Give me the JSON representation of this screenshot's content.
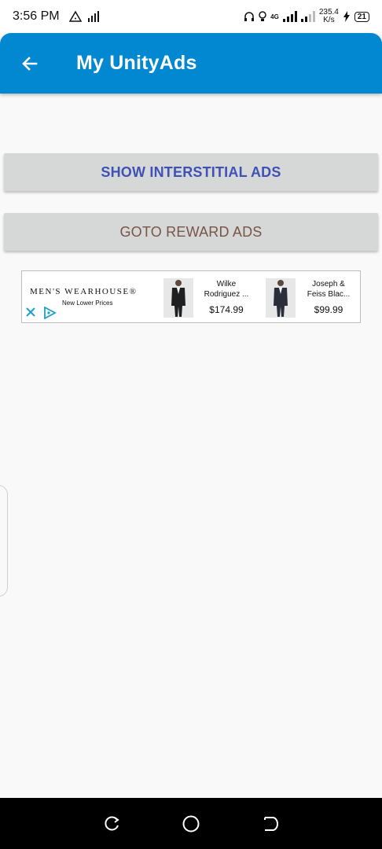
{
  "status_bar": {
    "time": "3:56 PM",
    "net_speed_value": "235.4",
    "net_speed_unit": "K/s",
    "network_type": "4G",
    "battery": "21"
  },
  "app_bar": {
    "title": "My UnityAds",
    "color": "#0288d1"
  },
  "buttons": {
    "interstitial_label": "SHOW INTERSTITIAL ADS",
    "reward_label": "GOTO REWARD ADS"
  },
  "ad": {
    "brand": "MEN'S WEARHOUSE®",
    "tagline": "New Lower Prices",
    "products": [
      {
        "name_line1": "Wilke",
        "name_line2": "Rodriguez ...",
        "price": "$174.99"
      },
      {
        "name_line1": "Joseph &",
        "name_line2": "Feiss Blac...",
        "price": "$99.99"
      }
    ]
  },
  "icons": {
    "back": "arrow-left-icon",
    "ad_close": "close-icon",
    "ad_choices": "adchoices-icon",
    "nav_recent": "recent-apps-icon",
    "nav_home": "home-icon",
    "nav_back": "back-icon"
  }
}
